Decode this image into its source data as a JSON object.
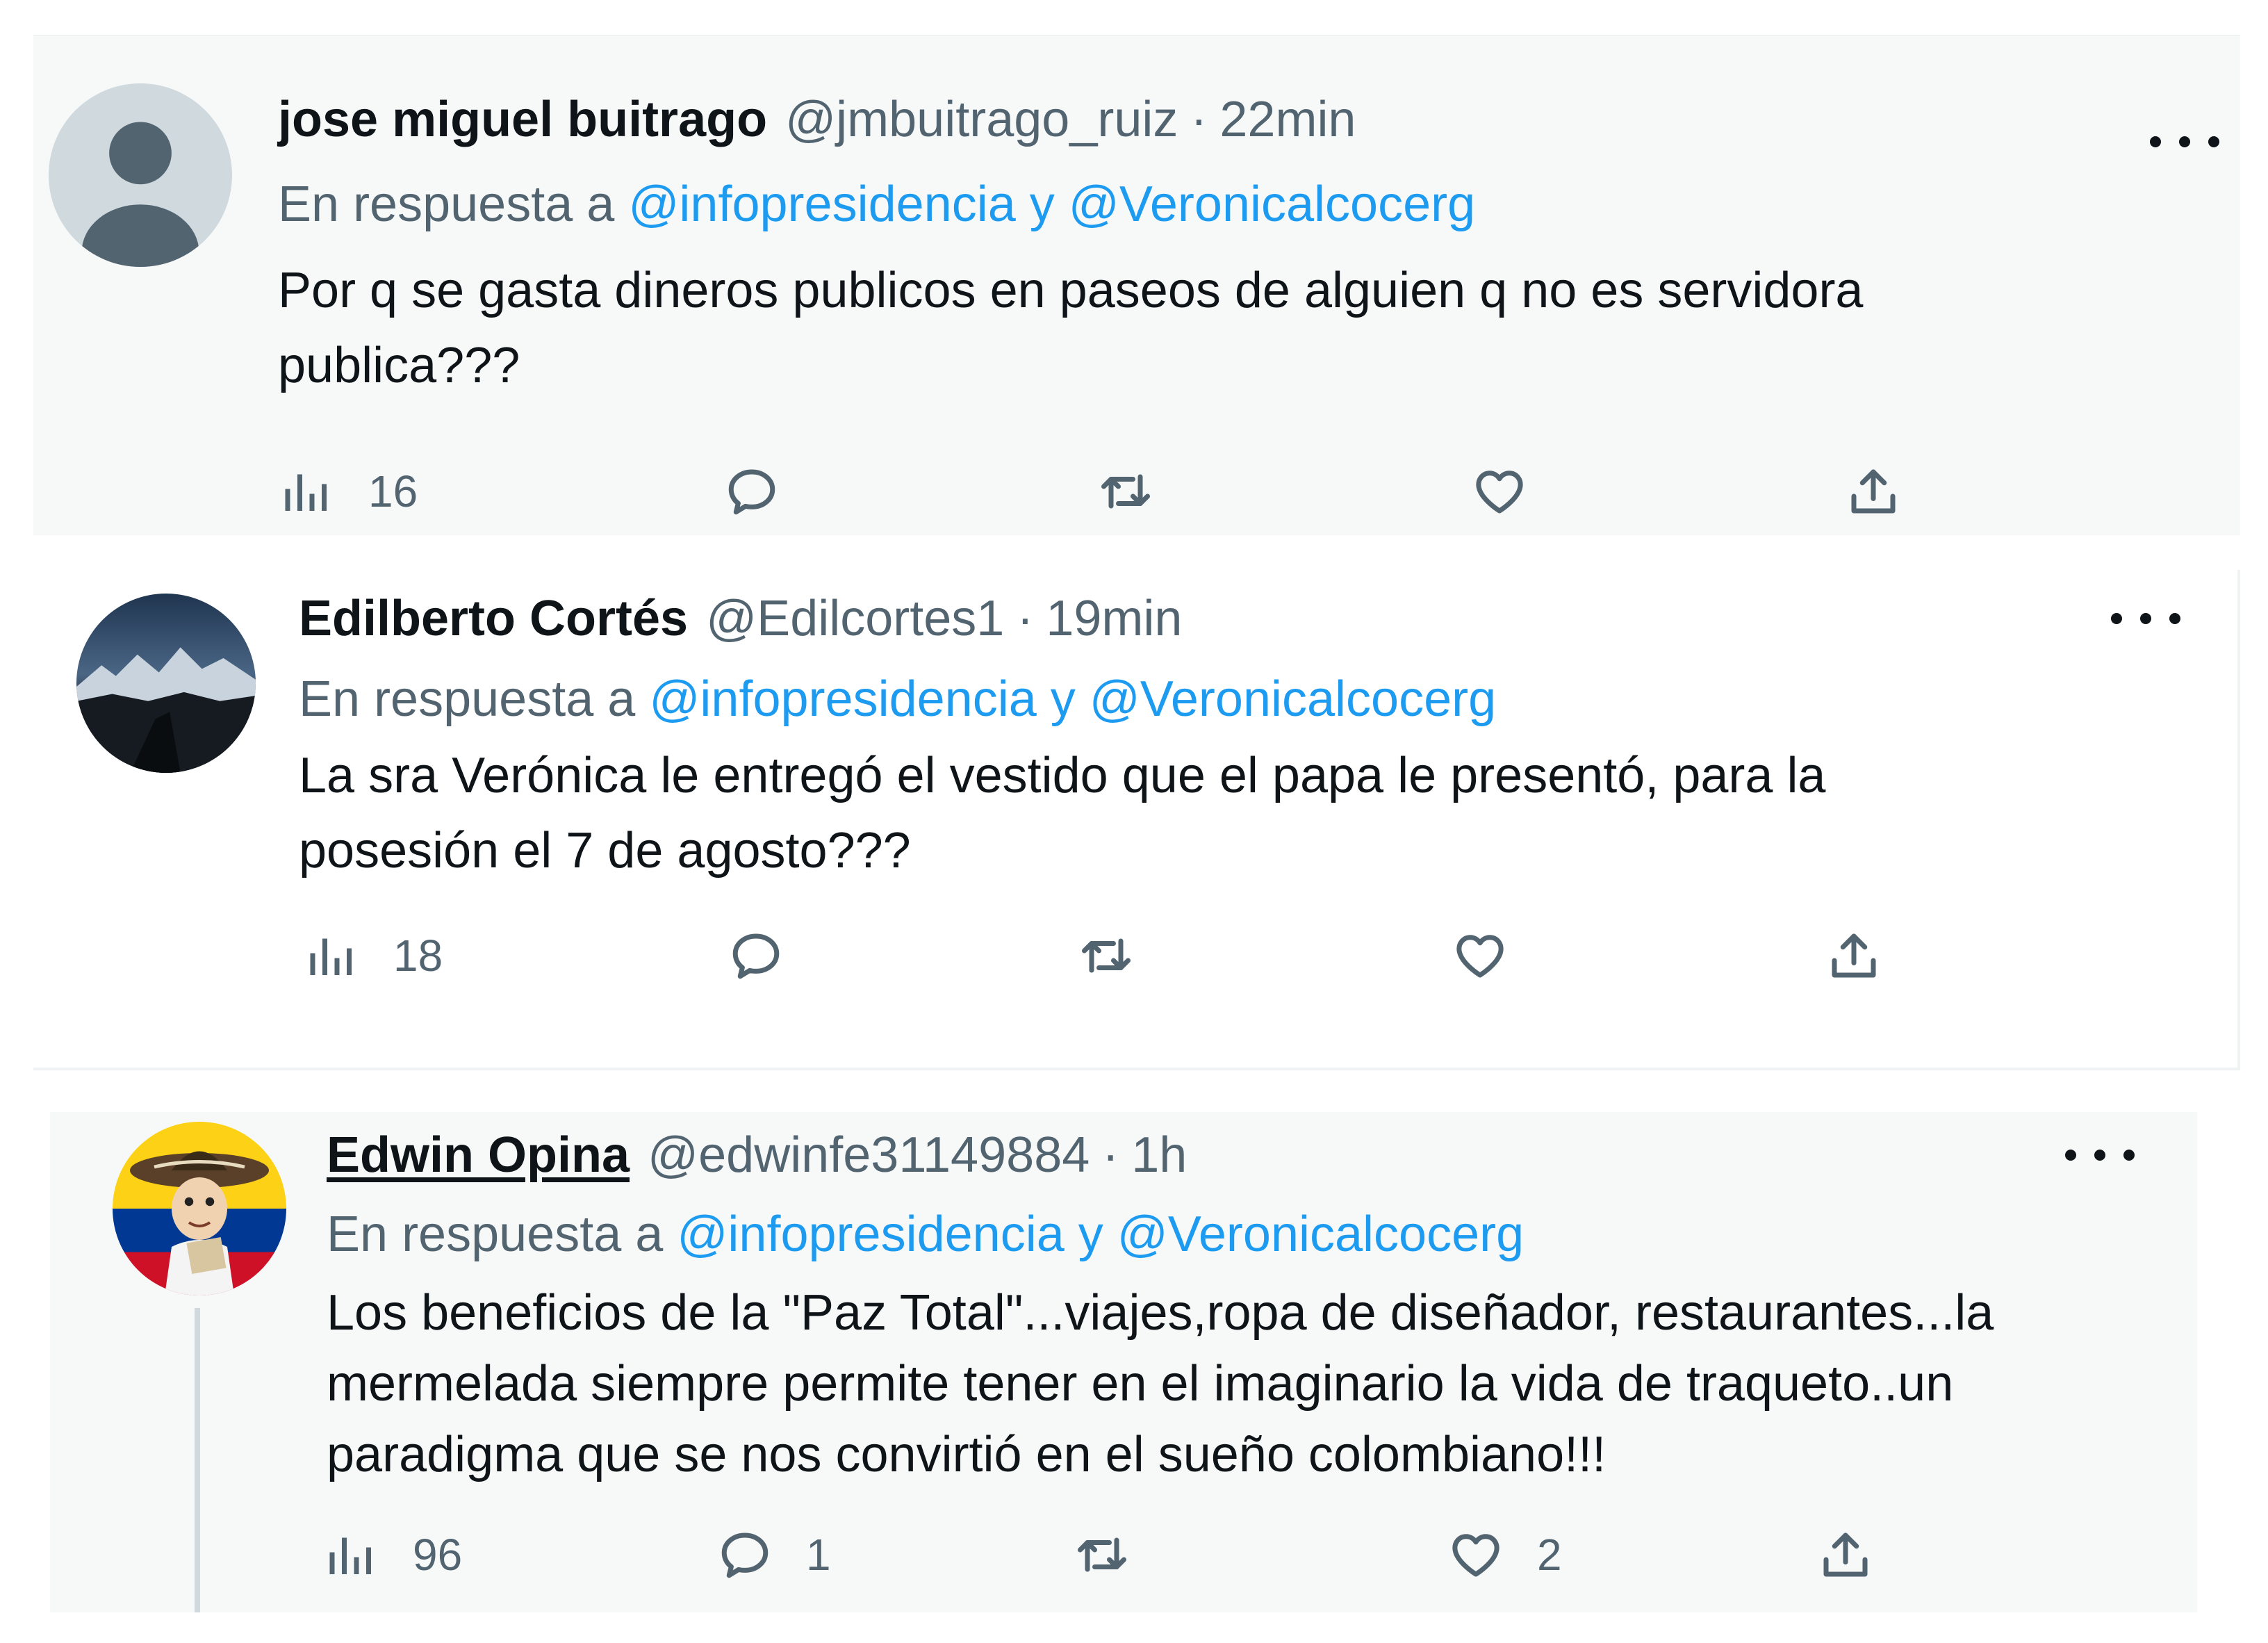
{
  "tweets": [
    {
      "name": "jose miguel buitrago",
      "handle": "@jmbuitrago_ruiz",
      "separator": "·",
      "time": "22min",
      "reply_prefix": "En respuesta a",
      "reply_mentions": "@infopresidencia y @Veronicalcocerg",
      "text_lines": [
        "Por q se gasta dineros publicos en paseos de alguien q no es servidora",
        "publica???"
      ],
      "views": "16",
      "replies": "",
      "retweets": "",
      "likes": ""
    },
    {
      "name": "Edilberto Cortés",
      "handle": "@Edilcortes1",
      "separator": "·",
      "time": "19min",
      "reply_prefix": "En respuesta a",
      "reply_mentions": "@infopresidencia y @Veronicalcocerg",
      "text_lines": [
        "La sra Verónica le entregó el vestido que el papa le presentó, para la",
        "posesión el 7 de agosto???"
      ],
      "views": "18",
      "replies": "",
      "retweets": "",
      "likes": ""
    },
    {
      "name": "Edwin Opina",
      "handle": "@edwinfe31149884",
      "separator": "·",
      "time": "1h",
      "reply_prefix": "En respuesta a",
      "reply_mentions": "@infopresidencia y @Veronicalcocerg",
      "text_lines": [
        "Los beneficios de la \"Paz Total\"...viajes,ropa de diseñador, restaurantes...la",
        "mermelada siempre permite tener en el imaginario la vida de traqueto..un",
        "paradigma que se nos convirtió en el sueño colombiano!!!"
      ],
      "views": "96",
      "replies": "1",
      "retweets": "",
      "likes": "2"
    }
  ],
  "icons": {
    "views": "bar-chart-icon",
    "reply": "speech-bubble-icon",
    "retweet": "retweet-arrows-icon",
    "like": "heart-icon",
    "share": "share-upload-icon",
    "more": "more-dots-icon"
  },
  "colors": {
    "mention": "#1d9bf0",
    "secondary_text": "#536471",
    "primary_text": "#0f1419",
    "card_bg": "#f7f9f9"
  }
}
